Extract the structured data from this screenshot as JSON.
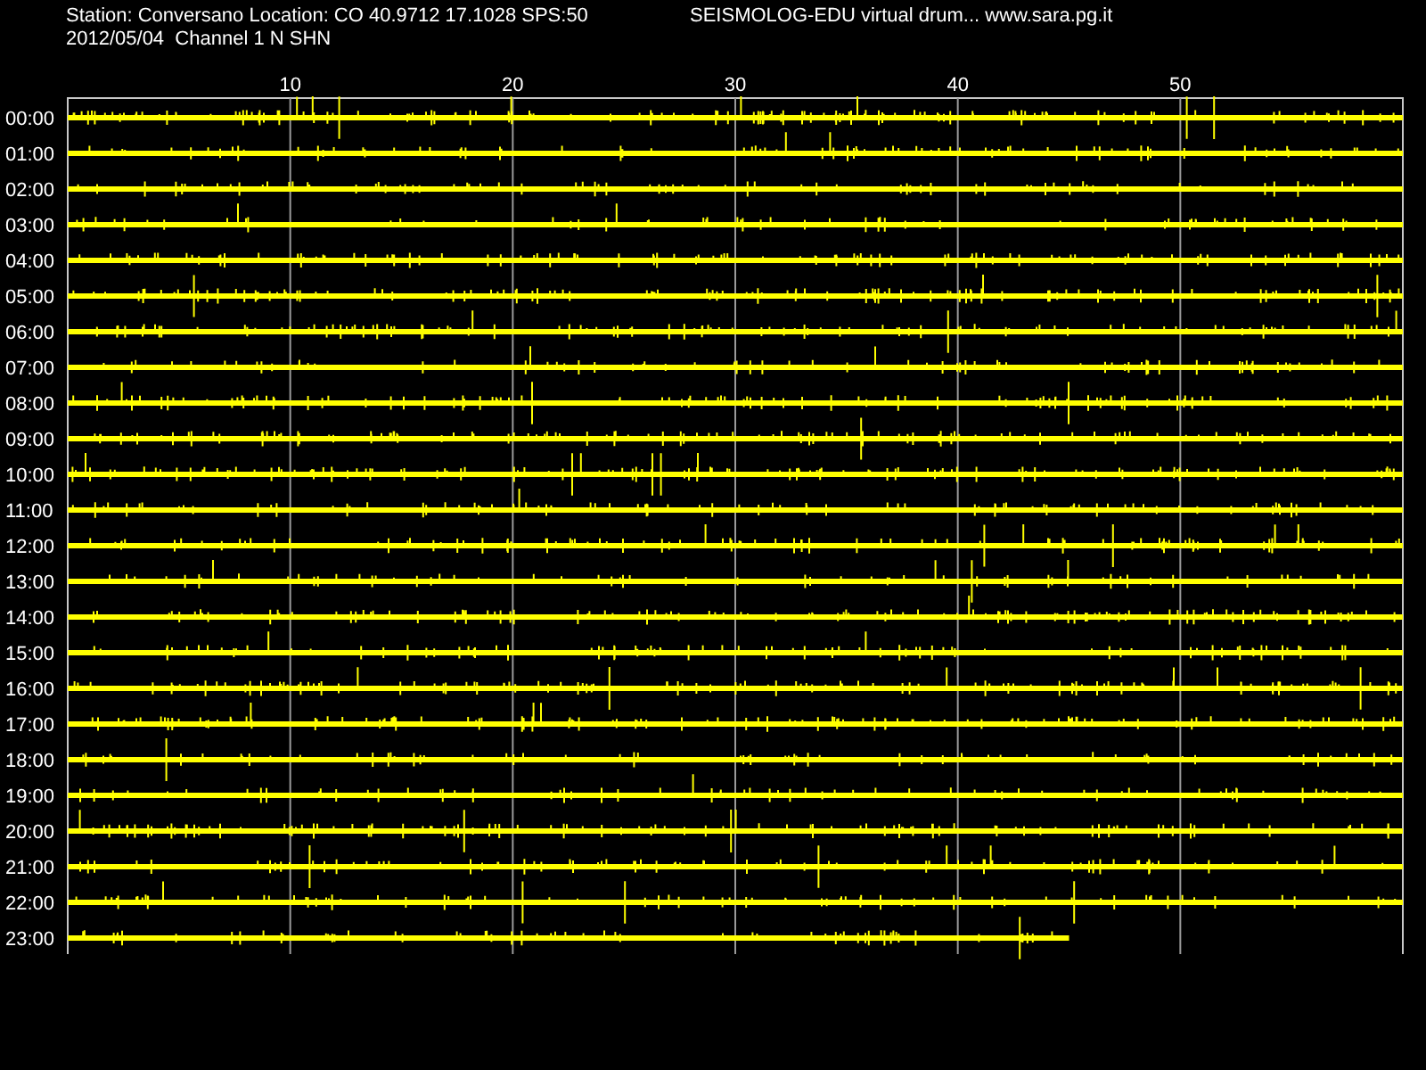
{
  "header": {
    "station_line": "Station: Conversano Location: CO 40.9712 17.1028 SPS:50",
    "title": "SEISMOLOG-EDU virtual drum... www.sara.pg.it",
    "date_line": "2012/05/04  Channel 1 N SHN"
  },
  "minute_labels": [
    "10",
    "20",
    "30",
    "40",
    "50"
  ],
  "rows": [
    {
      "time": "00:00",
      "level": 1
    },
    {
      "time": "01:00",
      "level": 1
    },
    {
      "time": "02:00",
      "level": 1
    },
    {
      "time": "03:00",
      "level": 1
    },
    {
      "time": "04:00",
      "level": 1
    },
    {
      "time": "05:00",
      "level": 1
    },
    {
      "time": "06:00",
      "level": 1
    },
    {
      "time": "07:00",
      "level": 1
    },
    {
      "time": "08:00",
      "level": 1
    },
    {
      "time": "09:00",
      "level": 1
    },
    {
      "time": "10:00",
      "level": 1
    },
    {
      "time": "11:00",
      "level": 1
    },
    {
      "time": "12:00",
      "level": 1
    },
    {
      "time": "13:00",
      "level": 1
    },
    {
      "time": "14:00",
      "level": 1
    },
    {
      "time": "15:00",
      "level": 1
    },
    {
      "time": "16:00",
      "level": 1
    },
    {
      "time": "17:00",
      "level": 1
    },
    {
      "time": "18:00",
      "level": 1
    },
    {
      "time": "19:00",
      "level": 1
    },
    {
      "time": "20:00",
      "level": 1
    },
    {
      "time": "21:00",
      "level": 1
    },
    {
      "time": "22:00",
      "level": 1
    },
    {
      "time": "23:00",
      "level": 0.75
    }
  ]
}
